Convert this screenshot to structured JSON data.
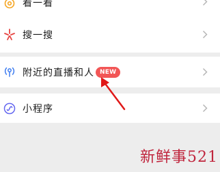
{
  "menu": {
    "items": [
      {
        "label": "看一看",
        "icon": "look-icon"
      },
      {
        "label": "搜一搜",
        "icon": "search-sparkle-icon"
      },
      {
        "label": "附近的直播和人",
        "icon": "nearby-icon",
        "badge": "NEW"
      },
      {
        "label": "小程序",
        "icon": "mini-program-icon"
      }
    ]
  },
  "watermark": "新鲜事521",
  "colors": {
    "background": "#ededed",
    "row": "#ffffff",
    "badge": "#f25656",
    "arrow": "#e01818",
    "watermark": "#c0253d",
    "look_icon": "#f5a623",
    "search_icon": "#e64340",
    "nearby_icon": "#3d7cf0",
    "mini_icon": "#6467f0"
  }
}
